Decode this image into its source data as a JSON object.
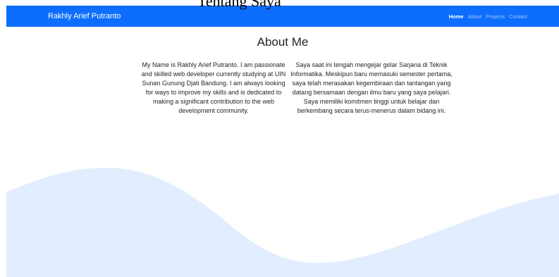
{
  "overflow_heading": "Tentang Saya",
  "navbar": {
    "brand": "Rakhly Arief Putranto",
    "links": [
      {
        "label": "Home",
        "active": true
      },
      {
        "label": "About",
        "active": false
      },
      {
        "label": "Projects",
        "active": false
      },
      {
        "label": "Contact",
        "active": false
      }
    ]
  },
  "about": {
    "title": "About Me",
    "paragraph_en": "My Name is Rakhly Arief Putranto. I am passionate and skilled web developer currently studying at UIN Sunan Gunung Djati Bandung. I am always looking for ways to improve my skills and is dedicated to making a significant contribution to the web development community.",
    "paragraph_id": "Saya saat ini tengah mengejar gelar Sarjana di Teknik Informatika. Meskipun baru memasuki semester pertama, saya telah merasakan kegembiraan dan tantangan yang datang bersamaan dengan ilmu baru yang saya pelajari. Saya memiliki komitmen tinggi untuk belajar dan berkembang secara terus-menerus dalam bidang ini."
  },
  "colors": {
    "navbar_bg": "#0d6efd",
    "wave_fill": "#e2edff",
    "text": "#212529"
  }
}
